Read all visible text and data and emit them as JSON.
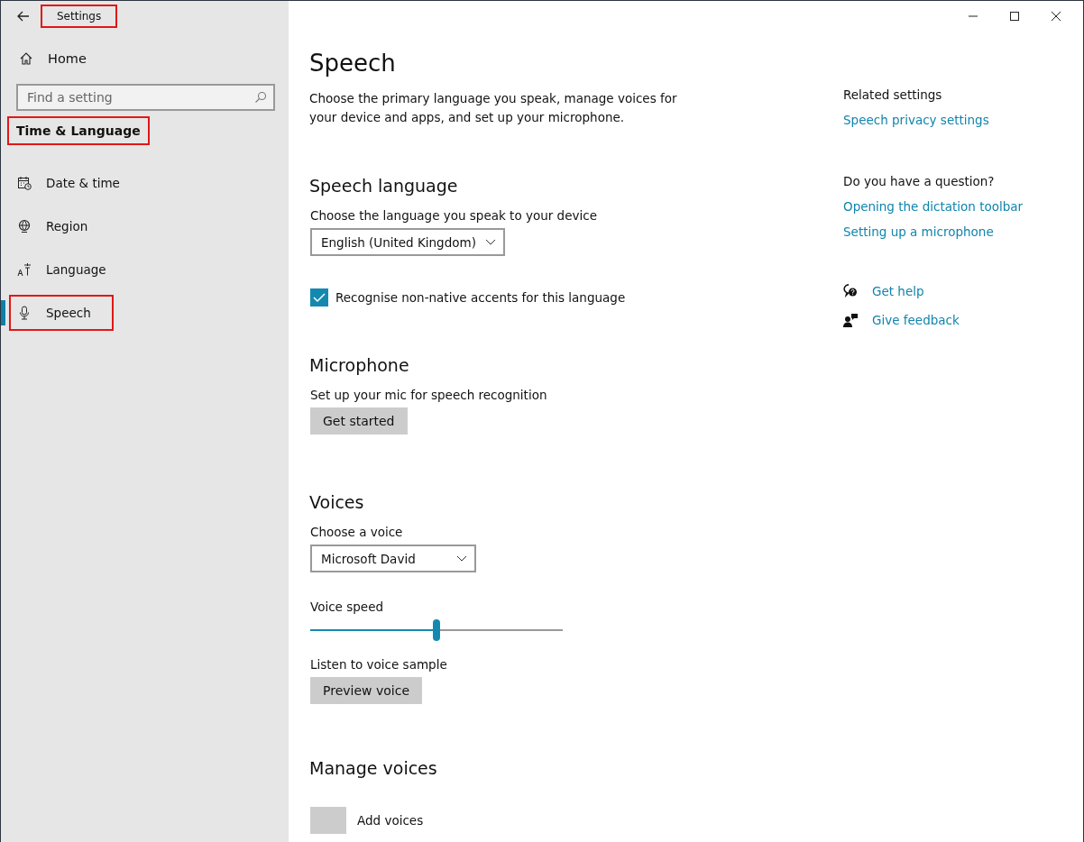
{
  "window": {
    "title": "Settings",
    "title_highlighted": true
  },
  "sidebar": {
    "home": "Home",
    "search": {
      "placeholder": "Find a setting"
    },
    "category": "Time & Language",
    "category_highlighted": true,
    "items": [
      {
        "label": "Date & time",
        "kind": "calendar",
        "selected": false,
        "highlighted": false
      },
      {
        "label": "Region",
        "kind": "globe",
        "selected": false,
        "highlighted": false
      },
      {
        "label": "Language",
        "kind": "language",
        "selected": false,
        "highlighted": false
      },
      {
        "label": "Speech",
        "kind": "microphone",
        "selected": true,
        "highlighted": true
      }
    ]
  },
  "page": {
    "title": "Speech",
    "intro": "Choose the primary language you speak, manage voices for your device and apps, and set up your microphone.",
    "speech_language": {
      "heading": "Speech language",
      "label": "Choose the language you speak to your device",
      "dropdown": "English (United Kingdom)",
      "checkbox": {
        "label": "Recognise non-native accents for this language",
        "checked": true
      }
    },
    "microphone": {
      "heading": "Microphone",
      "label": "Set up your mic for speech recognition",
      "button": "Get started"
    },
    "voices": {
      "heading": "Voices",
      "label": "Choose a voice",
      "dropdown": "Microsoft David",
      "speed_label": "Voice speed",
      "speed": {
        "level": 0.5
      },
      "sample_label": "Listen to voice sample",
      "button": "Preview voice"
    },
    "manage_voices": {
      "heading": "Manage voices",
      "add": "Add voices"
    }
  },
  "related": {
    "heading": "Related settings",
    "links": [
      "Speech privacy settings"
    ]
  },
  "question": {
    "heading": "Do you have a question?",
    "links": [
      "Opening the dictation toolbar",
      "Setting up a microphone"
    ]
  },
  "help": [
    {
      "label": "Get help",
      "kind": "help"
    },
    {
      "label": "Give feedback",
      "kind": "feedback"
    }
  ]
}
